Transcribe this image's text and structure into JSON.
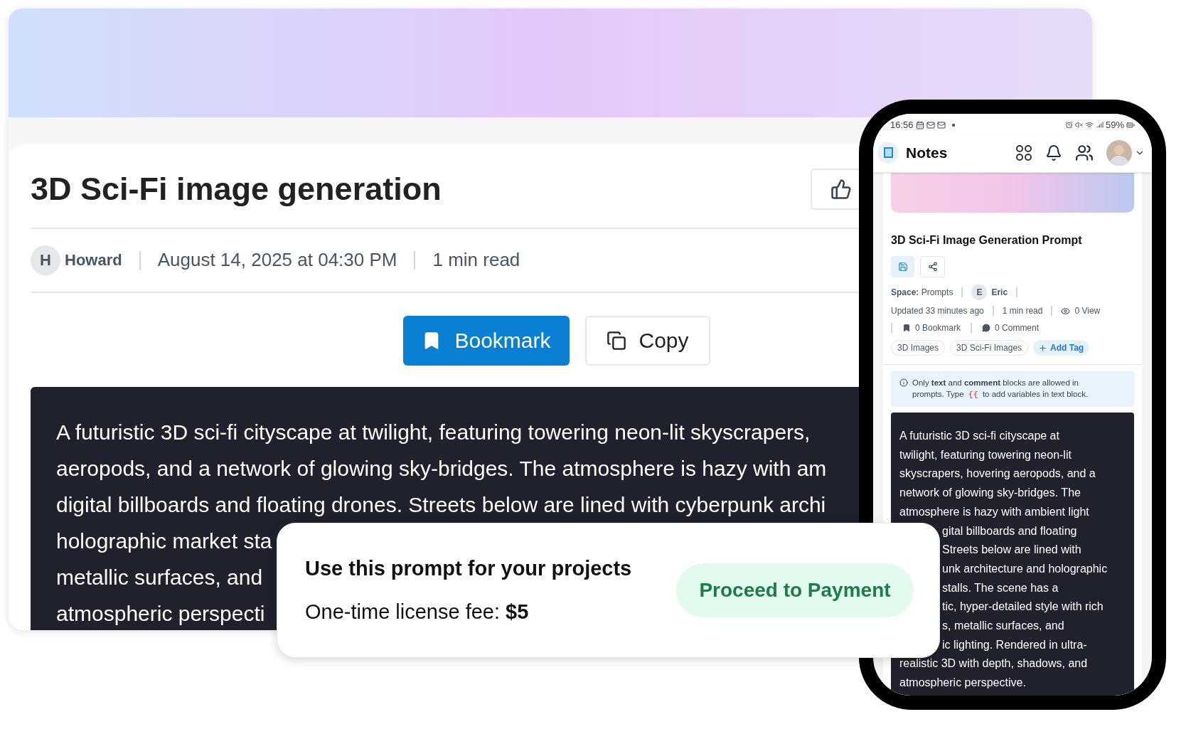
{
  "article": {
    "title": "3D Sci-Fi image generation",
    "author": {
      "initial": "H",
      "name": "Howard"
    },
    "date": "August 14, 2025 at 04:30 PM",
    "read_time": "1 min read",
    "actions": [
      {
        "label": "Bookmark",
        "kind": "primary"
      },
      {
        "label": "Copy",
        "kind": "secondary"
      }
    ],
    "prompt_lines": [
      "A futuristic 3D sci-fi cityscape at twilight, featuring towering neon-lit skyscrapers,",
      "aeropods, and a network of glowing sky-bridges. The atmosphere is hazy with am",
      "digital billboards and floating drones. Streets below are lined with cyberpunk archi",
      "holographic market sta",
      "metallic surfaces, and",
      "atmospheric perspecti"
    ]
  },
  "phone": {
    "status_bar": {
      "time": "16:56",
      "battery": "59%"
    },
    "app_title": "Notes",
    "note": {
      "title": "3D Sci-Fi Image Generation Prompt",
      "space_label": "Space:",
      "space": "Prompts",
      "author": {
        "initial": "E",
        "name": "Eric"
      },
      "updated": "Updated 33 minutes ago",
      "read_time": "1 min read",
      "views": "0 View",
      "bookmarks": "0 Bookmark",
      "comments": "0 Comment",
      "tags": [
        {
          "label": "3D Images",
          "kind": "tag"
        },
        {
          "label": "3D Sci-Fi Images",
          "kind": "tag"
        },
        {
          "label": "Add Tag",
          "kind": "add"
        }
      ],
      "info_before": "Only **text** and **comment** blocks are allowed in prompts. Type",
      "info_token": "{{",
      "info_after": "to add variables in text block.",
      "prompt_lines": [
        {
          "text": "A futuristic 3D sci-fi cityscape at",
          "kind": "full"
        },
        {
          "text": "twilight, featuring towering neon-lit",
          "kind": "full"
        },
        {
          "text": "skyscrapers, hovering aeropods, and a",
          "kind": "full"
        },
        {
          "text": "network of glowing sky-bridges. The",
          "kind": "full"
        },
        {
          "text": "atmosphere is hazy with ambient light",
          "kind": "full"
        },
        {
          "text": "gital billboards and floating",
          "kind": "partial"
        },
        {
          "text": "Streets below are lined with",
          "kind": "partial"
        },
        {
          "text": "unk architecture and holographic",
          "kind": "partial"
        },
        {
          "text": "stalls. The scene has a",
          "kind": "partial"
        },
        {
          "text": "tic, hyper-detailed style with rich",
          "kind": "partial"
        },
        {
          "text": "s, metallic surfaces, and",
          "kind": "partial"
        },
        {
          "text": "ic lighting. Rendered in ultra-",
          "kind": "partial"
        },
        {
          "text": "realistic 3D with depth, shadows, and",
          "kind": "full"
        },
        {
          "text": "atmospheric perspective.",
          "kind": "full"
        }
      ]
    }
  },
  "payment": {
    "heading": "Use this prompt for your projects",
    "fee": "One-time license fee: **$5**",
    "button": "Proceed to Payment"
  }
}
